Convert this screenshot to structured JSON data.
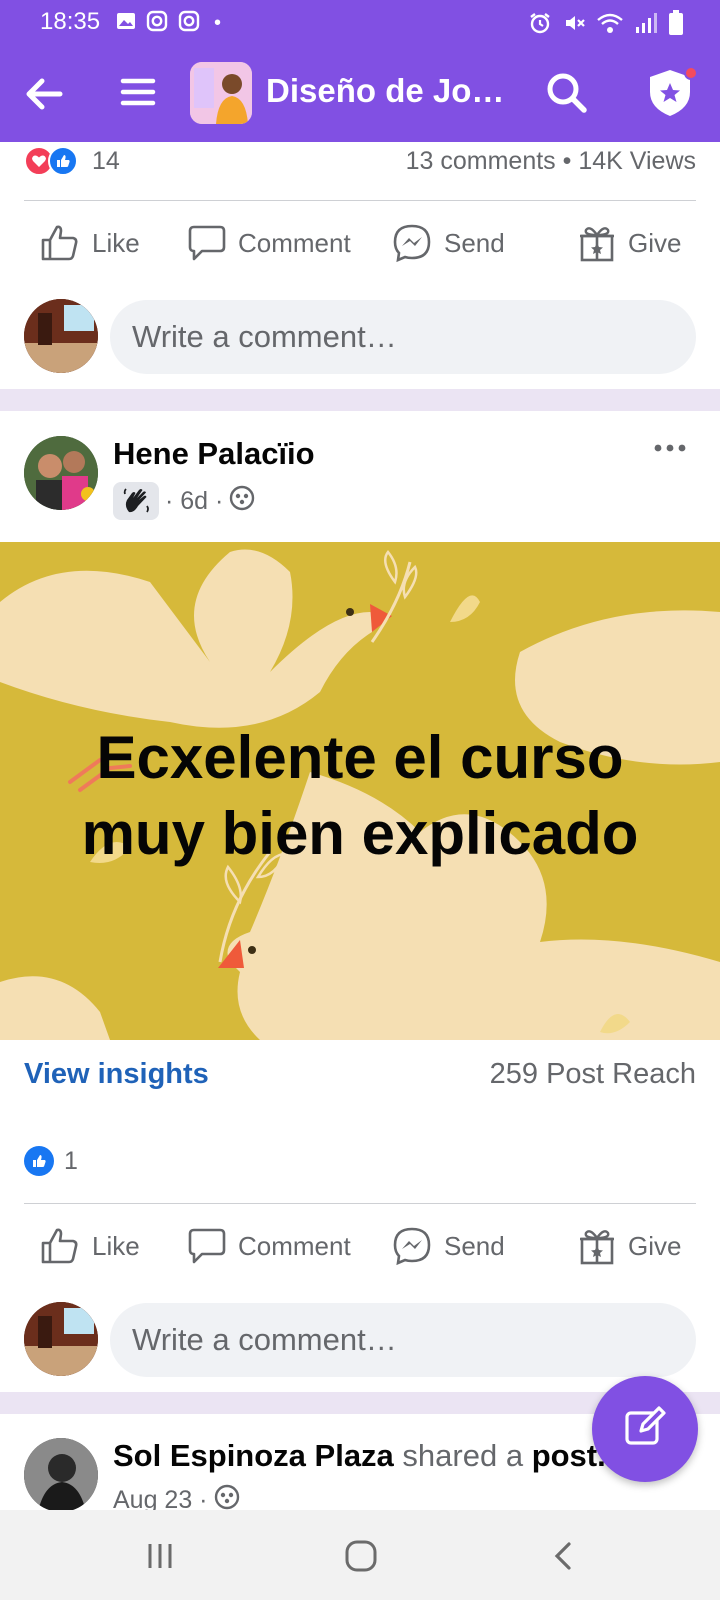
{
  "status_bar": {
    "time": "18:35",
    "dot": "•",
    "left_icons": [
      "gallery-icon",
      "instagram-icon",
      "instagram-icon"
    ],
    "right_icons": [
      "alarm-icon",
      "mute-icon",
      "wifi-icon",
      "signal-icon",
      "battery-icon"
    ]
  },
  "app_bar": {
    "title": "Diseño de Joy…",
    "background": "#8150e3",
    "icons": [
      "back-arrow-icon",
      "menu-icon",
      "search-icon",
      "shield-star-icon"
    ]
  },
  "previous_post": {
    "reaction_count": "14",
    "comments_views": "13 comments • 14K Views",
    "actions": [
      "Like",
      "Comment",
      "Send",
      "Give"
    ],
    "comment_placeholder": "Write a comment…"
  },
  "post": {
    "author": "Hene Palacïio",
    "time": "· 6d ·",
    "image_text_line1": "Ecxelente el curso",
    "image_text_line2": "muy bien explicado",
    "image_background": "#d6b93a",
    "insights_label": "View insights",
    "post_reach": "259 Post Reach",
    "like_count": "1",
    "actions": [
      "Like",
      "Comment",
      "Send",
      "Give"
    ],
    "comment_placeholder": "Write a comment…"
  },
  "next_post": {
    "author": "Sol Espinoza Plaza",
    "shared_text": " shared a ",
    "post_word": "post.",
    "date": "Aug 23 ·"
  },
  "nav_bar": {
    "buttons": [
      "recents-icon",
      "home-icon",
      "back-icon"
    ]
  },
  "colors": {
    "brand_purple": "#8150e3",
    "link_blue": "#1f62b8",
    "muted_text": "#65676b"
  }
}
